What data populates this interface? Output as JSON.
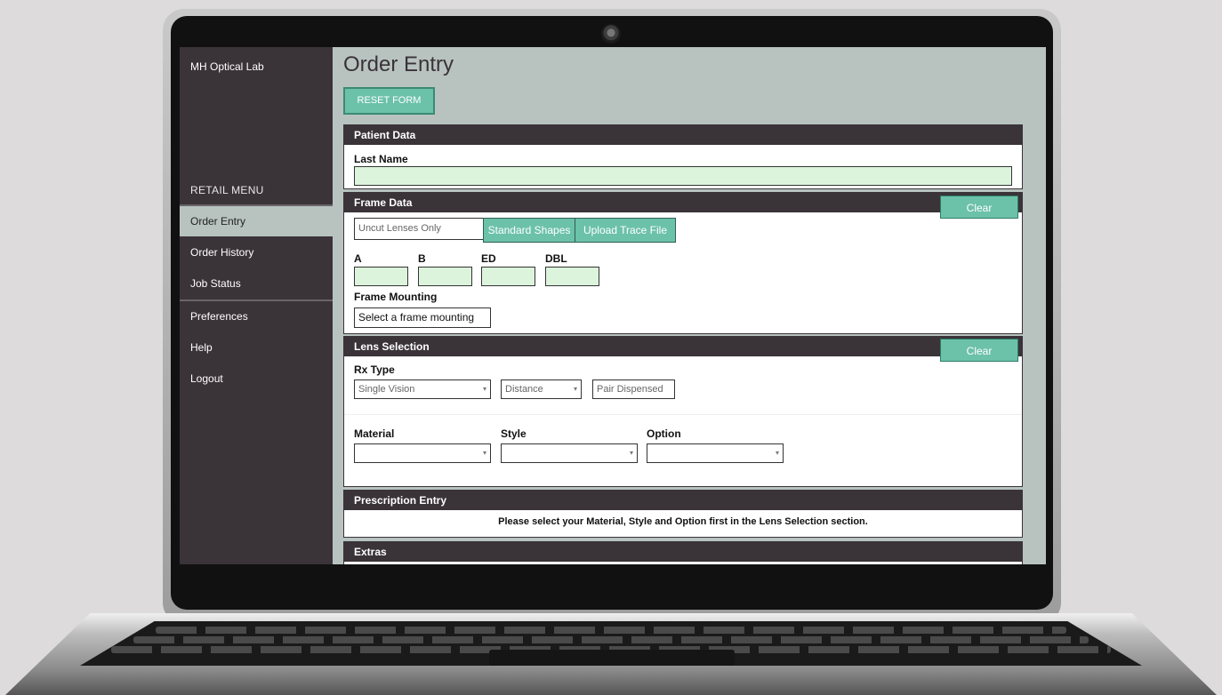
{
  "app": {
    "brand": "MH Optical Lab",
    "page_title": "Order Entry",
    "reset_label": "RESET FORM"
  },
  "sidebar": {
    "heading": "RETAIL MENU",
    "items": [
      {
        "label": "Order Entry",
        "active": true
      },
      {
        "label": "Order History"
      },
      {
        "label": "Job Status"
      },
      {
        "label": "Preferences"
      },
      {
        "label": "Help"
      },
      {
        "label": "Logout"
      }
    ]
  },
  "patient": {
    "title": "Patient Data",
    "last_name_label": "Last Name",
    "last_name_value": ""
  },
  "frame": {
    "title": "Frame Data",
    "clear_label": "Clear",
    "lens_type_value": "Uncut Lenses Only",
    "standard_shapes_label": "Standard Shapes",
    "upload_label": "Upload Trace File",
    "measure_labels": {
      "a": "A",
      "b": "B",
      "ed": "ED",
      "dbl": "DBL"
    },
    "mounting_label": "Frame Mounting",
    "mounting_value": "Select a frame mounting"
  },
  "lens": {
    "title": "Lens Selection",
    "clear_label": "Clear",
    "rx_type_label": "Rx Type",
    "rx_type_value": "Single Vision",
    "distance_value": "Distance",
    "pair_value": "Pair Dispensed",
    "material_label": "Material",
    "style_label": "Style",
    "option_label": "Option",
    "material_value": "",
    "style_value": "",
    "option_value": ""
  },
  "prescription": {
    "title": "Prescription Entry",
    "notice": "Please select your Material, Style and Option first in the Lens Selection section."
  },
  "extras": {
    "title": "Extras"
  },
  "colors": {
    "accent": "#6cc1a9",
    "dark": "#3a3338",
    "content_bg": "#b8c3bf",
    "input_fill": "#dcf4dc"
  }
}
